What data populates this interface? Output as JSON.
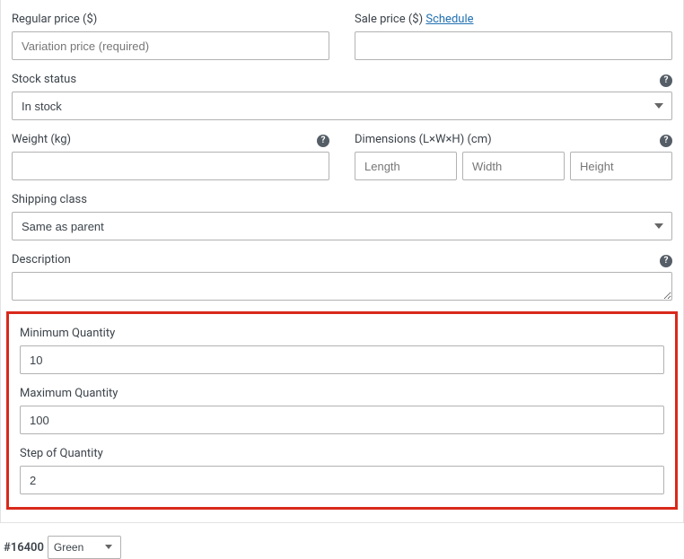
{
  "price": {
    "regular_label": "Regular price ($)",
    "regular_placeholder": "Variation price (required)",
    "regular_value": "",
    "sale_label": "Sale price ($) ",
    "schedule_link": "Schedule",
    "sale_value": ""
  },
  "stock": {
    "label": "Stock status",
    "value": "In stock"
  },
  "weight": {
    "label": "Weight (kg)",
    "value": ""
  },
  "dimensions": {
    "label": "Dimensions (L×W×H) (cm)",
    "length_placeholder": "Length",
    "length_value": "",
    "width_placeholder": "Width",
    "width_value": "",
    "height_placeholder": "Height",
    "height_value": ""
  },
  "shipping_class": {
    "label": "Shipping class",
    "value": "Same as parent"
  },
  "description": {
    "label": "Description",
    "value": ""
  },
  "quantity": {
    "min_label": "Minimum Quantity",
    "min_value": "10",
    "max_label": "Maximum Quantity",
    "max_value": "100",
    "step_label": "Step of Quantity",
    "step_value": "2"
  },
  "variation": {
    "id_prefix": "#",
    "id_value": "16400",
    "attribute_value": "Green"
  },
  "help_glyph": "?"
}
